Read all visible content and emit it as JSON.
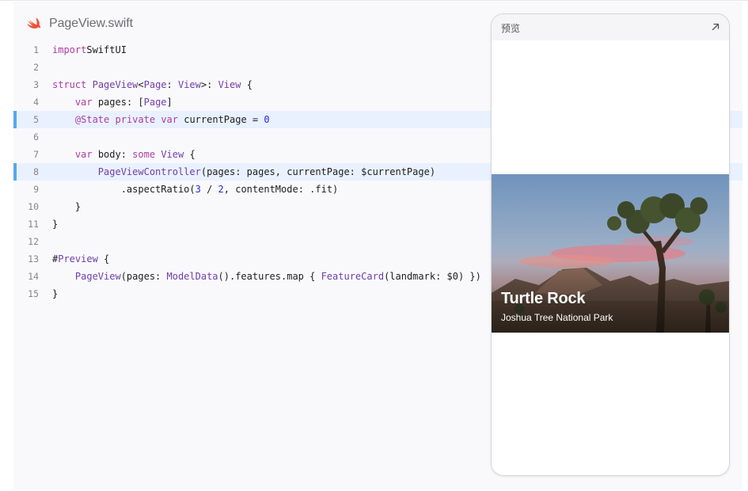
{
  "file": {
    "name": "PageView.swift",
    "icon": "swift-icon"
  },
  "code": {
    "highlighted_lines": [
      5,
      8
    ],
    "lines": [
      {
        "n": "1",
        "tokens": [
          [
            "kw",
            "import"
          ],
          [
            "",
            "SwiftUI"
          ]
        ]
      },
      {
        "n": "2",
        "tokens": []
      },
      {
        "n": "3",
        "tokens": [
          [
            "kw",
            "struct"
          ],
          [
            "",
            " "
          ],
          [
            "ty",
            "PageView"
          ],
          [
            "",
            "<"
          ],
          [
            "ty",
            "Page"
          ],
          [
            "",
            ": "
          ],
          [
            "ty",
            "View"
          ],
          [
            "",
            ">: "
          ],
          [
            "ty",
            "View"
          ],
          [
            "",
            " {"
          ]
        ]
      },
      {
        "n": "4",
        "tokens": [
          [
            "",
            "    "
          ],
          [
            "kw",
            "var"
          ],
          [
            "",
            " pages: ["
          ],
          [
            "ty",
            "Page"
          ],
          [
            "",
            "]"
          ]
        ]
      },
      {
        "n": "5",
        "tokens": [
          [
            "",
            "    "
          ],
          [
            "kw",
            "@State"
          ],
          [
            "",
            " "
          ],
          [
            "kw",
            "private"
          ],
          [
            "",
            " "
          ],
          [
            "kw",
            "var"
          ],
          [
            "",
            " currentPage = "
          ],
          [
            "num",
            "0"
          ]
        ]
      },
      {
        "n": "6",
        "tokens": []
      },
      {
        "n": "7",
        "tokens": [
          [
            "",
            "    "
          ],
          [
            "kw",
            "var"
          ],
          [
            "",
            " body: "
          ],
          [
            "kw",
            "some"
          ],
          [
            "",
            " "
          ],
          [
            "ty",
            "View"
          ],
          [
            "",
            " {"
          ]
        ]
      },
      {
        "n": "8",
        "tokens": [
          [
            "",
            "        "
          ],
          [
            "ty",
            "PageViewController"
          ],
          [
            "",
            "(pages: pages, currentPage: $currentPage)"
          ]
        ]
      },
      {
        "n": "9",
        "tokens": [
          [
            "",
            "            .aspectRatio("
          ],
          [
            "num",
            "3"
          ],
          [
            "",
            " / "
          ],
          [
            "num",
            "2"
          ],
          [
            "",
            ", contentMode: .fit)"
          ]
        ]
      },
      {
        "n": "10",
        "tokens": [
          [
            "",
            "    }"
          ]
        ]
      },
      {
        "n": "11",
        "tokens": [
          [
            "",
            "}"
          ]
        ]
      },
      {
        "n": "12",
        "tokens": []
      },
      {
        "n": "13",
        "tokens": [
          [
            "",
            "#"
          ],
          [
            "ty",
            "Preview"
          ],
          [
            "",
            " {"
          ]
        ]
      },
      {
        "n": "14",
        "tokens": [
          [
            "",
            "    "
          ],
          [
            "ty",
            "PageView"
          ],
          [
            "",
            "(pages: "
          ],
          [
            "ty",
            "ModelData"
          ],
          [
            "",
            "().features.map { "
          ],
          [
            "ty",
            "FeatureCard"
          ],
          [
            "",
            "(landmark: $0) })"
          ]
        ]
      },
      {
        "n": "15",
        "tokens": [
          [
            "",
            "}"
          ]
        ]
      }
    ]
  },
  "preview": {
    "title": "预览",
    "expand_icon": "arrow-up-right-icon",
    "card": {
      "title": "Turtle Rock",
      "subtitle": "Joshua Tree National Park"
    }
  },
  "colors": {
    "keyword": "#ad3da4",
    "type": "#703daa",
    "number": "#272ad8",
    "highlight": "#e9f1fe",
    "highlight_bar": "#5aa7e6",
    "swift": "#f05138"
  }
}
